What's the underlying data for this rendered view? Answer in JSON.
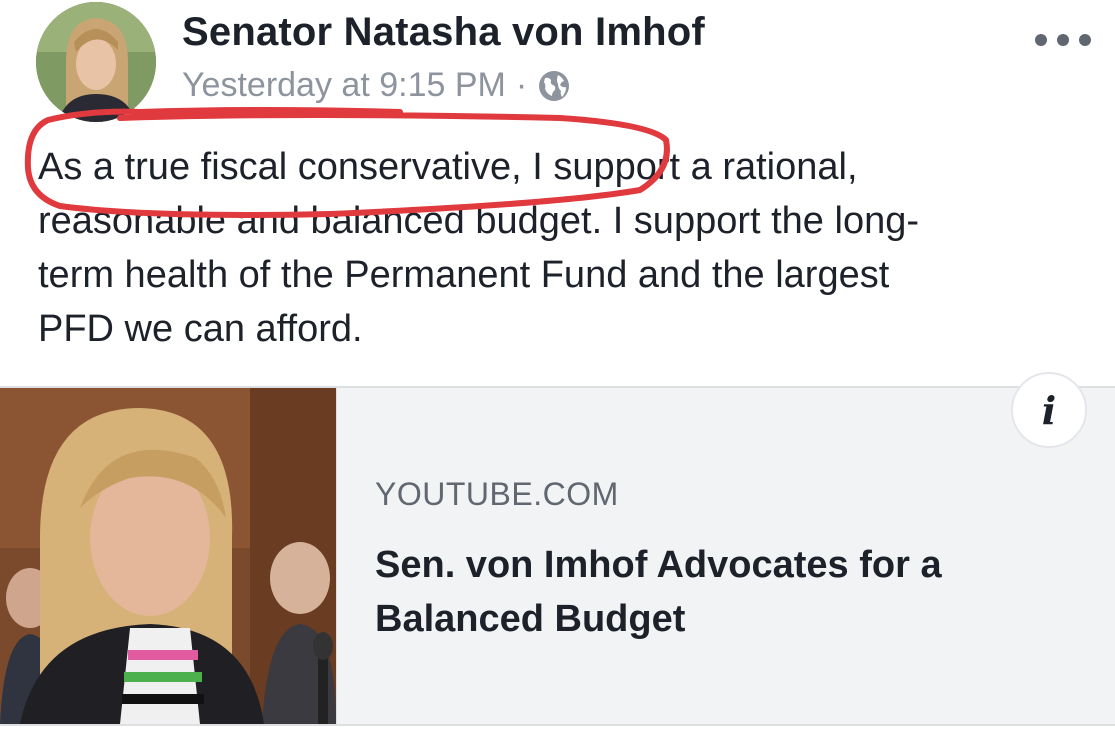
{
  "post": {
    "author": "Senator Natasha von Imhof",
    "timestamp": "Yesterday at 9:15 PM",
    "separator": "·",
    "privacy_icon": "globe-icon",
    "menu_icon": "more-options-icon",
    "text_lines": [
      "As a true fiscal conservative, I support a rational,",
      "reasonable and balanced budget. I support the long-",
      "term health of the Permanent Fund and the largest",
      "PFD we can afford."
    ]
  },
  "annotation": {
    "shape": "hand-drawn ellipse",
    "color": "#e0393e"
  },
  "link_card": {
    "domain": "YOUTUBE.COM",
    "title": "Sen. von Imhof Advocates for a Balanced Budget",
    "info_label": "i",
    "thumbnail": "woman-speaking-thumbnail"
  },
  "colors": {
    "name": "#1d2129",
    "meta": "#8d949e",
    "card_bg": "#f2f3f5",
    "annotation": "#e0393e"
  }
}
